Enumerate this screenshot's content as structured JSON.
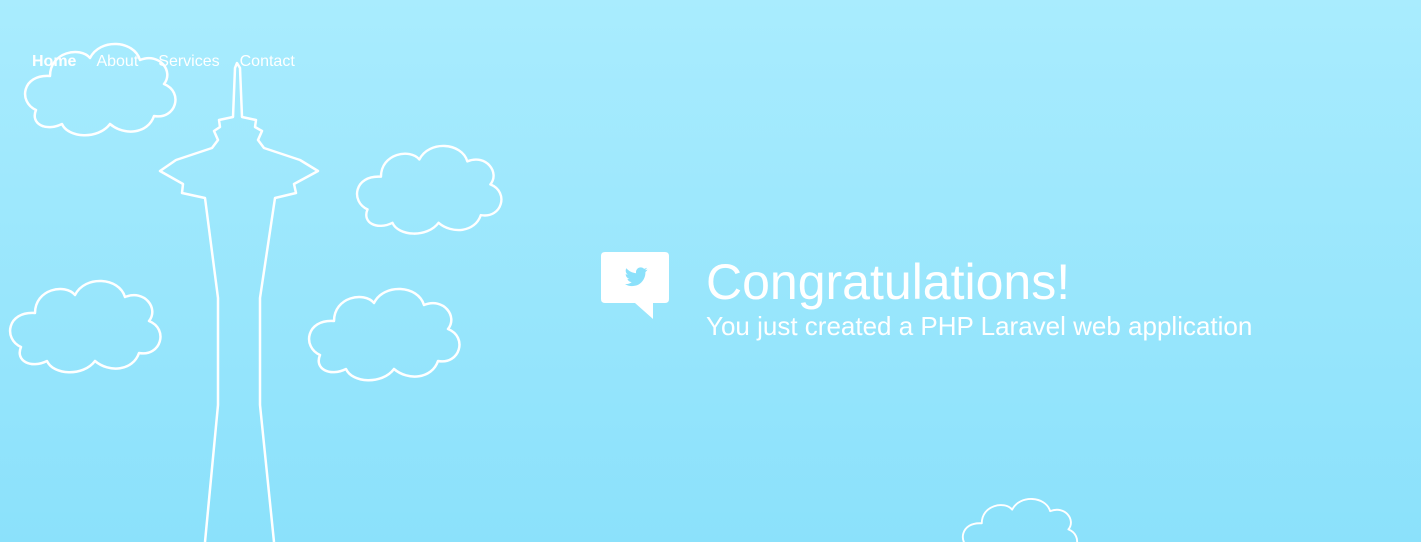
{
  "nav": {
    "items": [
      {
        "label": "Home",
        "active": true
      },
      {
        "label": "About",
        "active": false
      },
      {
        "label": "Services",
        "active": false
      },
      {
        "label": "Contact",
        "active": false
      }
    ]
  },
  "hero": {
    "title": "Congratulations!",
    "subtitle": "You just created a PHP Laravel web application",
    "icon": "twitter-bubble-icon"
  },
  "colors": {
    "sky_top": "#a9ecfe",
    "sky_bottom": "#8be1fb",
    "foreground": "#ffffff",
    "bird": "#8be1fb"
  }
}
